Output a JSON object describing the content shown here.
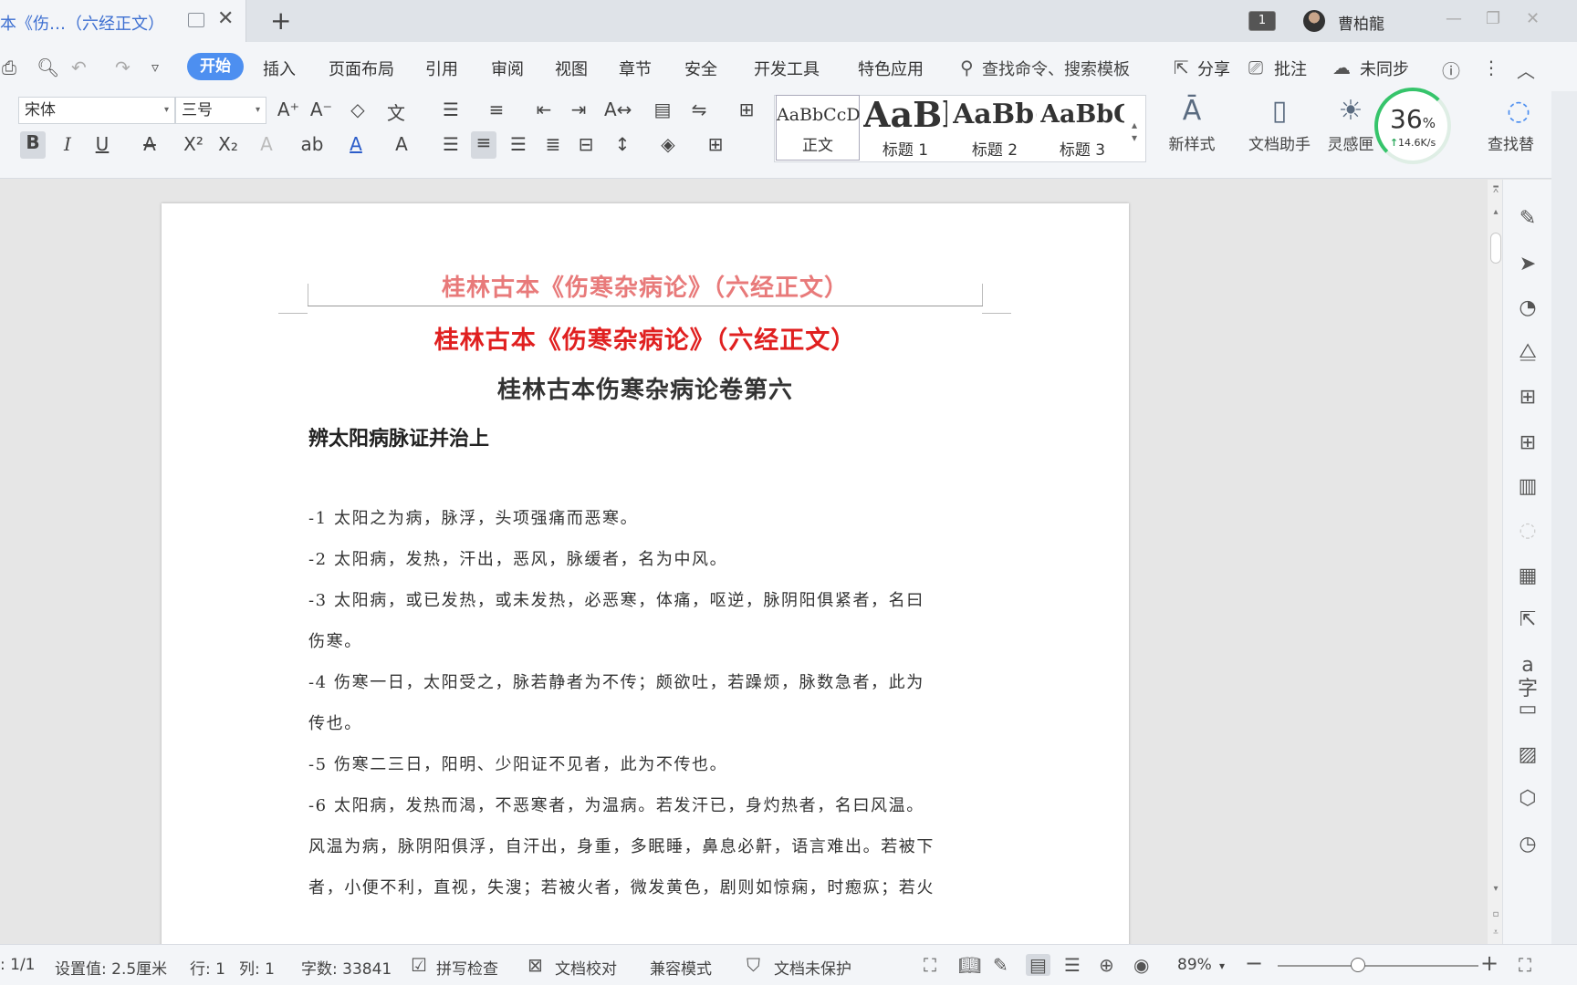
{
  "titlebar": {
    "tab_title": "本《伤…（六经正文）",
    "page_count_badge": "1",
    "username": "曹柏龍"
  },
  "menu": {
    "items": [
      "开始",
      "插入",
      "页面布局",
      "引用",
      "审阅",
      "视图",
      "章节",
      "安全",
      "开发工具",
      "特色应用"
    ],
    "search_placeholder": "查找命令、搜索模板",
    "share": "分享",
    "comment": "批注",
    "sync": "未同步"
  },
  "toolbar": {
    "font_name": "宋体",
    "font_size": "三号",
    "styles": [
      {
        "sample": "AaBbCcDd",
        "label": "正文"
      },
      {
        "sample": "AaBl",
        "label": "标题 1"
      },
      {
        "sample": "AaBb(",
        "label": "标题 2"
      },
      {
        "sample": "AaBbC",
        "label": "标题 3"
      }
    ],
    "new_style": "新样式",
    "doc_assistant": "文档助手",
    "inspiration": "灵感匣",
    "find": "查找替"
  },
  "progress": {
    "percent": "36",
    "percent_unit": "%",
    "speed": "14.6K/s"
  },
  "document": {
    "header": "桂林古本《伤寒杂病论》（六经正文）",
    "title": "桂林古本《伤寒杂病论》（六经正文）",
    "subtitle": "桂林古本伤寒杂病论卷第六",
    "section": "辨太阳病脉证并治上",
    "lines": [
      "-1 太阳之为病，脉浮，头项强痛而恶寒。",
      "-2 太阳病，发热，汗出，恶风，脉缓者，名为中风。",
      "-3 太阳病，或已发热，或未发热，必恶寒，体痛，呕逆，脉阴阳俱紧者，名曰",
      "伤寒。",
      "-4 伤寒一日，太阳受之，脉若静者为不传；颇欲吐，若躁烦，脉数急者，此为",
      "传也。",
      "-5 伤寒二三日，阳明、少阳证不见者，此为不传也。",
      "-6 太阳病，发热而渴，不恶寒者，为温病。若发汗已，身灼热者，名曰风温。",
      "风温为病，脉阴阳俱浮，自汗出，身重，多眠睡，鼻息必鼾，语言难出。若被下",
      "者，小便不利，直视，失溲；若被火者，微发黄色，剧则如惊痫，时瘛疭；若火"
    ]
  },
  "statusbar": {
    "page": ": 1/1",
    "setting": "设置值: 2.5厘米",
    "row": "行: 1",
    "col": "列: 1",
    "word_count": "字数: 33841",
    "spell_check": "拼写检查",
    "doc_proof": "文档校对",
    "compat_mode": "兼容模式",
    "protect": "文档未保护",
    "zoom": "89%"
  },
  "zoom_level": 0.36
}
